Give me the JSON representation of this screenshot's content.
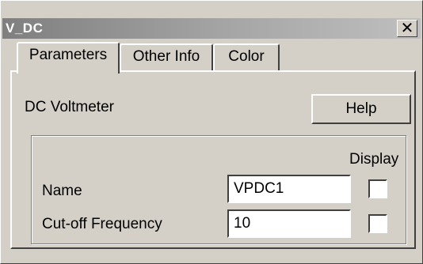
{
  "window": {
    "title": "V_DC",
    "close_glyph": "✕"
  },
  "tabs": [
    {
      "label": "Parameters",
      "active": true
    },
    {
      "label": "Other Info",
      "active": false
    },
    {
      "label": "Color",
      "active": false
    }
  ],
  "panel": {
    "description": "DC Voltmeter",
    "help_label": "Help",
    "display_header": "Display",
    "fields": [
      {
        "label": "Name",
        "value": "VPDC1",
        "display_checked": false
      },
      {
        "label": "Cut-off Frequency",
        "value": "10",
        "display_checked": false
      }
    ]
  },
  "colors": {
    "face": "#d4d0c8",
    "title_gradient_start": "#7f7f7f",
    "title_gradient_end": "#bfbfbf"
  }
}
